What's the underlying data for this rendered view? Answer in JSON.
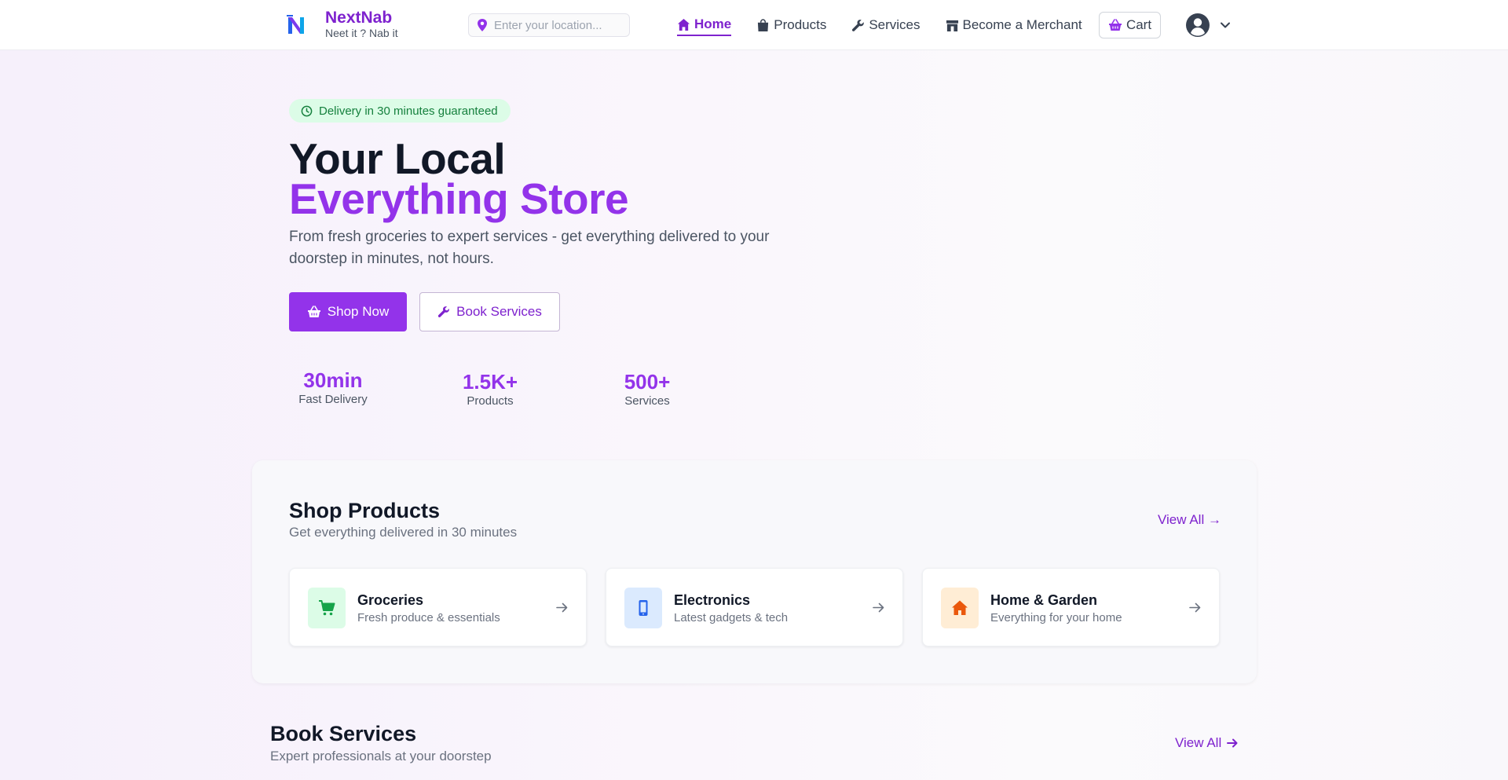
{
  "navbar": {
    "brand_name": "NextNab",
    "brand_tagline": "Neet it ? Nab it",
    "location_placeholder": "Enter your location...",
    "links": [
      {
        "label": "Home",
        "icon": "home-icon",
        "active": true
      },
      {
        "label": "Products",
        "icon": "shopping-bag-icon",
        "active": false
      },
      {
        "label": "Services",
        "icon": "wrench-icon",
        "active": false
      },
      {
        "label": "Become a Merchant",
        "icon": "store-icon",
        "active": false
      }
    ],
    "cart_label": "Cart",
    "icons": {
      "location": "map-pin-icon",
      "cart": "basket-icon",
      "user": "user-circle-icon",
      "menu": "chevron-down-icon"
    }
  },
  "hero": {
    "badge": "Delivery in 30 minutes guaranteed",
    "title_line1": "Your Local",
    "title_line2": "Everything Store",
    "subtitle": "From fresh groceries to expert services - get everything delivered to your doorstep in minutes, not hours.",
    "primary_cta": "Shop Now",
    "secondary_cta": "Book Services",
    "stats": [
      {
        "value": "30min",
        "label": "Fast Delivery"
      },
      {
        "value": "1.5K+",
        "label": "Products"
      },
      {
        "value": "500+",
        "label": "Services"
      }
    ]
  },
  "shop_products": {
    "title": "Shop Products",
    "subtitle": "Get everything delivered in 30 minutes",
    "view_all": "View All →",
    "categories": [
      {
        "title": "Groceries",
        "subtitle": "Fresh produce & essentials",
        "icon": "cart-icon",
        "color": "#16a34a",
        "bg": "#dcfce7"
      },
      {
        "title": "Electronics",
        "subtitle": "Latest gadgets & tech",
        "icon": "phone-icon",
        "color": "#2563eb",
        "bg": "#dbeafe"
      },
      {
        "title": "Home & Garden",
        "subtitle": "Everything for your home",
        "icon": "house-icon",
        "color": "#ea580c",
        "bg": "#ffedd5"
      }
    ]
  },
  "book_services": {
    "title": "Book Services",
    "subtitle": "Expert professionals at your doorstep",
    "view_all": "View All"
  },
  "colors": {
    "brand": "#9333ea",
    "brand_dark": "#7e22ce",
    "success": "#15803d"
  }
}
